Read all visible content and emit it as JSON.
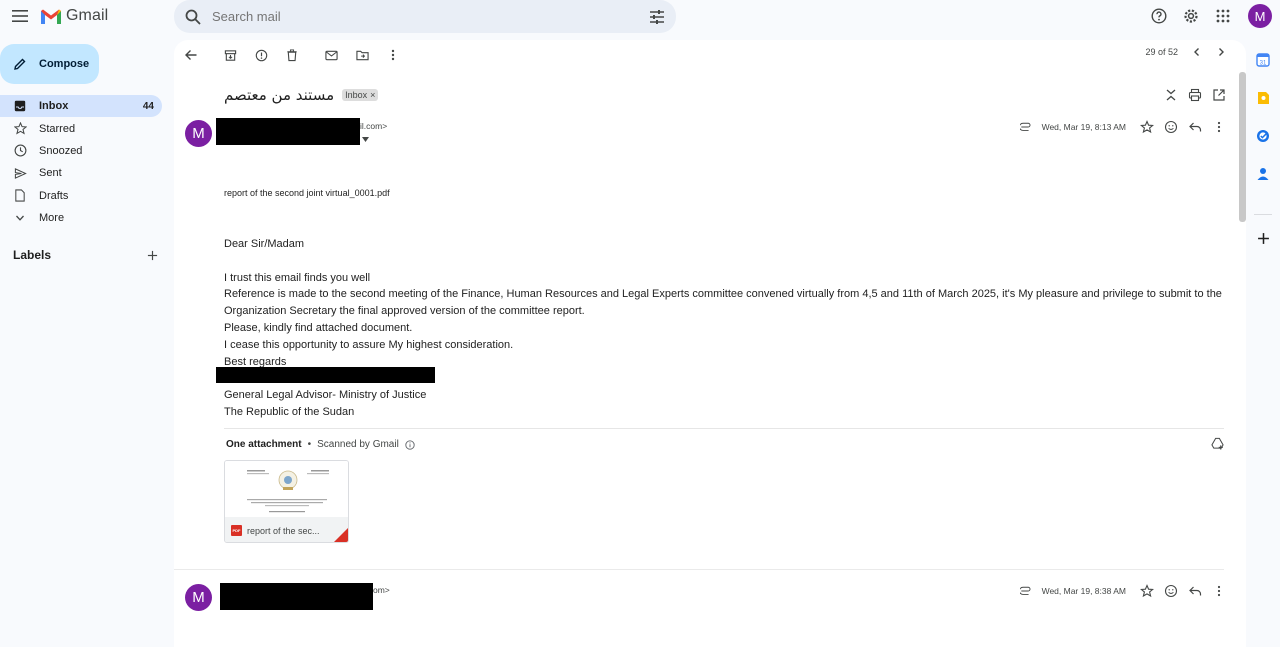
{
  "app": {
    "name": "Gmail",
    "search_placeholder": "Search mail",
    "avatar_letter": "M",
    "accent": "#c2e7ff",
    "avatar_color": "#7b1fa2"
  },
  "sidebar": {
    "compose": "Compose",
    "items": [
      {
        "label": "Inbox",
        "icon": "inbox-icon",
        "count": "44",
        "active": true
      },
      {
        "label": "Starred",
        "icon": "star-icon"
      },
      {
        "label": "Snoozed",
        "icon": "clock-icon"
      },
      {
        "label": "Sent",
        "icon": "send-icon"
      },
      {
        "label": "Drafts",
        "icon": "draft-icon"
      },
      {
        "label": "More",
        "icon": "chevron-down-icon"
      }
    ],
    "labels_title": "Labels"
  },
  "toolbar": {
    "pager": "29 of 52"
  },
  "thread": {
    "subject": "مستند من معتصم",
    "label_chip": "Inbox",
    "messages": [
      {
        "avatar": "M",
        "sender_tail": "il.com>",
        "date": "Wed, Mar 19, 8:13 AM",
        "inline_attachment": "report of the second joint virtual_0001.pdf",
        "body": [
          "Dear Sir/Madam",
          "",
          "I trust this email finds you well",
          "Reference is made to the second meeting  of the Finance, Human Resources  and Legal Experts committee  convened virtually from 4,5 and 11th  of March 2025,  it's My pleasure and privilege to submit to the Organization Secretary the final approved version of the committee report.",
          "Please,  kindly  find attached document.",
          "I cease this opportunity to assure My highest consideration.",
          "Best regards",
          "",
          "General Legal  Advisor- Ministry of Justice",
          "The Republic of the Sudan"
        ],
        "attachments_header": "One attachment",
        "scanned": "Scanned by Gmail",
        "attachment_name": "report of the sec..."
      },
      {
        "avatar": "M",
        "sender_tail": "om>",
        "date": "Wed, Mar 19, 8:38 AM"
      }
    ]
  }
}
